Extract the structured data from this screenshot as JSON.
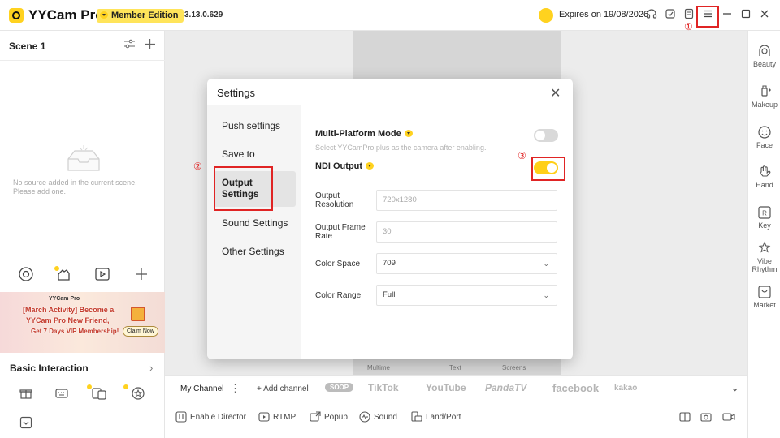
{
  "titlebar": {
    "app_name": "YYCam Pro",
    "edition": "Member Edition",
    "version": "3.13.0.629",
    "expires": "Expires on 19/08/2026"
  },
  "callouts": [
    "①",
    "②",
    "③"
  ],
  "scene": {
    "title": "Scene 1",
    "empty_text": "No source added in the current scene. Please add one."
  },
  "banner": {
    "brand": "YYCam Pro",
    "line1": "[March Activity] Become a",
    "line2": "YYCam Pro New Friend,",
    "line3": "Get 7 Days VIP Membership!",
    "button": "Claim Now"
  },
  "basic_interaction": {
    "title": "Basic Interaction"
  },
  "right_panel": {
    "items": [
      "Beauty",
      "Makeup",
      "Face",
      "Hand",
      "Key",
      "Vibe Rhythm",
      "Market"
    ]
  },
  "preview_tabs": [
    "Multime",
    "Text",
    "Screens"
  ],
  "channel_bar": {
    "label": "My Channel",
    "add": "+ Add channel",
    "platforms": [
      "SOOP",
      "TikTok",
      "YouTube",
      "PandaTV",
      "facebook",
      "kakao"
    ]
  },
  "bottom_tools": [
    "Enable Director",
    "RTMP",
    "Popup",
    "Sound",
    "Land/Port"
  ],
  "settings": {
    "title": "Settings",
    "nav": [
      "Push settings",
      "Save to",
      "Output Settings",
      "Sound Settings",
      "Other Settings"
    ],
    "active_nav": "Output Settings",
    "multi_platform": {
      "label": "Multi-Platform Mode",
      "hint": "Select YYCamPro plus as the camera after enabling.",
      "enabled": false
    },
    "ndi": {
      "label": "NDI Output",
      "enabled": true
    },
    "fields": [
      {
        "label": "Output Resolution",
        "value": "720x1280"
      },
      {
        "label": "Output Frame Rate",
        "value": "30"
      },
      {
        "label": "Color Space",
        "value": "709"
      },
      {
        "label": "Color Range",
        "value": "Full"
      }
    ]
  },
  "colors": {
    "accent": "#ffcf18",
    "highlight": "#e02424"
  }
}
